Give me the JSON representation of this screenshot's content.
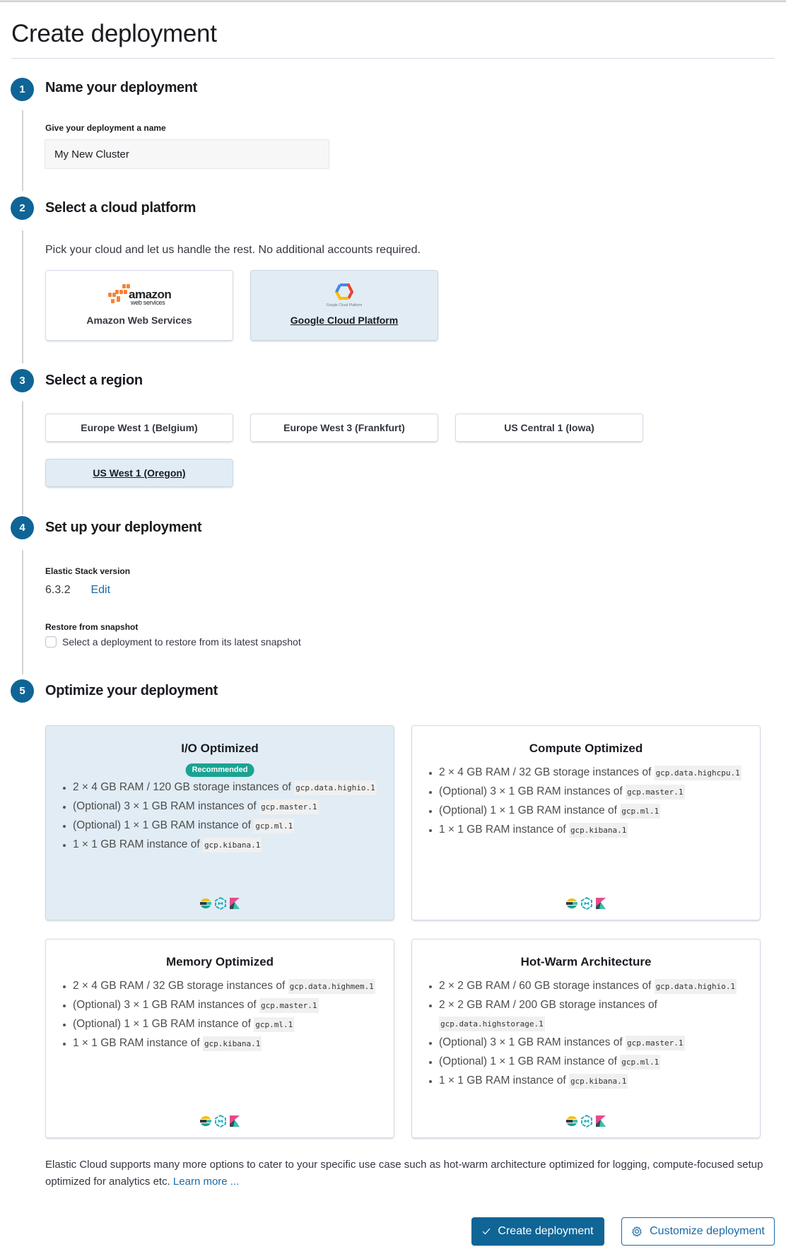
{
  "page": {
    "title": "Create deployment"
  },
  "steps": [
    {
      "number": "1",
      "title": "Name your deployment"
    },
    {
      "number": "2",
      "title": "Select a cloud platform"
    },
    {
      "number": "3",
      "title": "Select a region"
    },
    {
      "number": "4",
      "title": "Set up your deployment"
    },
    {
      "number": "5",
      "title": "Optimize your deployment"
    }
  ],
  "name_step": {
    "label": "Give your deployment a name",
    "value": "My New Cluster"
  },
  "cloud_step": {
    "description": "Pick your cloud and let us handle the rest. No additional accounts required.",
    "options": [
      {
        "label": "Amazon Web Services",
        "logo": "aws-logo",
        "logo_text": "amazon",
        "logo_subtext": "web services",
        "selected": false
      },
      {
        "label": "Google Cloud Platform",
        "logo": "gcp-logo",
        "logo_text": "Google Cloud Platform",
        "selected": true
      }
    ]
  },
  "region_step": {
    "options": [
      {
        "label": "Europe West 1 (Belgium)",
        "selected": false
      },
      {
        "label": "Europe West 3 (Frankfurt)",
        "selected": false
      },
      {
        "label": "US Central 1 (Iowa)",
        "selected": false
      },
      {
        "label": "US West 1 (Oregon)",
        "selected": true
      }
    ]
  },
  "setup_step": {
    "version_label": "Elastic Stack version",
    "version": "6.3.2",
    "edit_label": "Edit",
    "restore_label": "Restore from snapshot",
    "restore_checkbox_label": "Select a deployment to restore from its latest snapshot",
    "restore_checked": false
  },
  "optimize_step": {
    "cards": [
      {
        "title": "I/O Optimized",
        "badge": "Recommended",
        "selected": true,
        "items": [
          {
            "text": "2 × 4 GB RAM / 120 GB storage instances of ",
            "code": "gcp.data.highio.1"
          },
          {
            "text": "(Optional) 3 × 1 GB RAM instances of ",
            "code": "gcp.master.1"
          },
          {
            "text": "(Optional) 1 × 1 GB RAM instance of ",
            "code": "gcp.ml.1"
          },
          {
            "text": "1 × 1 GB RAM instance of ",
            "code": "gcp.kibana.1"
          }
        ],
        "icons": [
          "elasticsearch-icon",
          "machine-learning-icon",
          "kibana-icon"
        ]
      },
      {
        "title": "Compute Optimized",
        "badge": null,
        "selected": false,
        "items": [
          {
            "text": "2 × 4 GB RAM / 32 GB storage instances of ",
            "code": "gcp.data.highcpu.1"
          },
          {
            "text": "(Optional) 3 × 1 GB RAM instances of ",
            "code": "gcp.master.1"
          },
          {
            "text": "(Optional) 1 × 1 GB RAM instance of ",
            "code": "gcp.ml.1"
          },
          {
            "text": "1 × 1 GB RAM instance of ",
            "code": "gcp.kibana.1"
          }
        ],
        "icons": [
          "elasticsearch-icon",
          "machine-learning-icon",
          "kibana-icon"
        ]
      },
      {
        "title": "Memory Optimized",
        "badge": null,
        "selected": false,
        "items": [
          {
            "text": "2 × 4 GB RAM / 32 GB storage instances of ",
            "code": "gcp.data.highmem.1"
          },
          {
            "text": "(Optional) 3 × 1 GB RAM instances of ",
            "code": "gcp.master.1"
          },
          {
            "text": "(Optional) 1 × 1 GB RAM instance of ",
            "code": "gcp.ml.1"
          },
          {
            "text": "1 × 1 GB RAM instance of ",
            "code": "gcp.kibana.1"
          }
        ],
        "icons": [
          "elasticsearch-icon",
          "machine-learning-icon",
          "kibana-icon"
        ]
      },
      {
        "title": "Hot-Warm Architecture",
        "badge": null,
        "selected": false,
        "items": [
          {
            "text": "2 × 2 GB RAM / 60 GB storage instances of ",
            "code": "gcp.data.highio.1"
          },
          {
            "text": "2 × 2 GB RAM / 200 GB storage instances of ",
            "code": "gcp.data.highstorage.1"
          },
          {
            "text": "(Optional) 3 × 1 GB RAM instances of ",
            "code": "gcp.master.1"
          },
          {
            "text": "(Optional) 1 × 1 GB RAM instance of ",
            "code": "gcp.ml.1"
          },
          {
            "text": "1 × 1 GB RAM instance of ",
            "code": "gcp.kibana.1"
          }
        ],
        "icons": [
          "elasticsearch-icon",
          "machine-learning-icon",
          "kibana-icon"
        ]
      }
    ]
  },
  "footer": {
    "text": "Elastic Cloud supports many more options to cater to your specific use case such as hot-warm architecture optimized for logging, compute-focused setup optimized for analytics etc. ",
    "learn_more": "Learn more ..."
  },
  "actions": {
    "create_label": "Create deployment",
    "create_icon": "check-icon",
    "customize_label": "Customize deployment",
    "customize_icon": "gear-icon"
  },
  "colors": {
    "primary": "#0f6596",
    "link": "#1a6aa8",
    "selected_bg": "#e1ecf4",
    "badge": "#1ba392"
  }
}
